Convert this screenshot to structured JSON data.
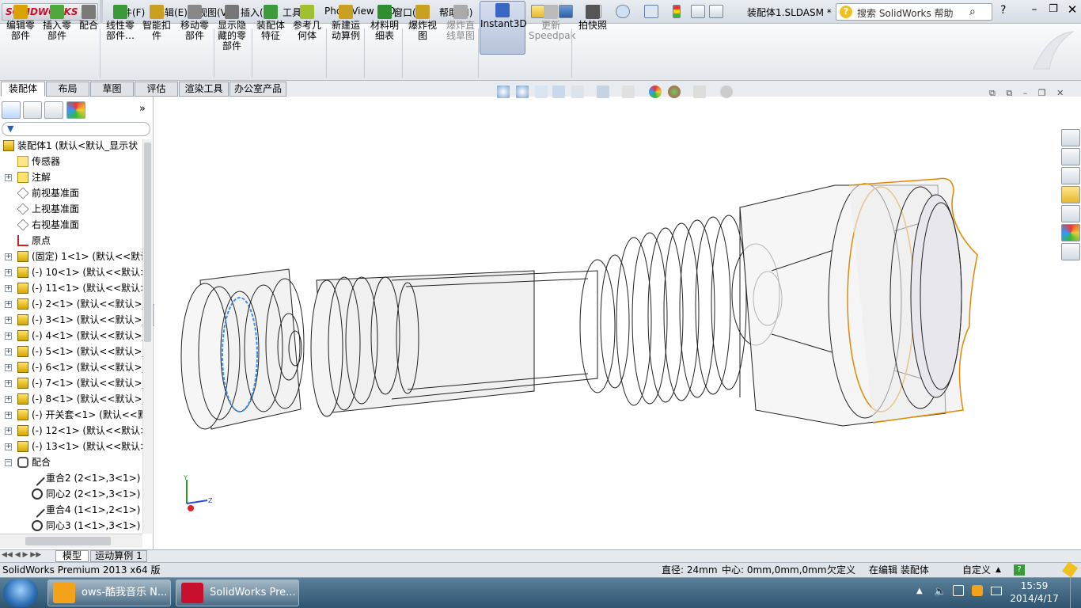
{
  "app": {
    "logo": "SOLIDWORKS",
    "doc_title": "装配体1.SLDASM *",
    "search_placeholder": "搜索 SolidWorks 帮助"
  },
  "menu": [
    "文件(F)",
    "编辑(E)",
    "视图(V)",
    "插入(I)",
    "工具(T)",
    "PhotoView 360",
    "窗口(W)",
    "帮助(H)"
  ],
  "ribbon": [
    {
      "label": "编辑零\n部件",
      "icon": "edit-component-icon",
      "color": "#d9a400"
    },
    {
      "label": "插入零\n部件",
      "icon": "insert-component-icon",
      "color": "#4fa83a"
    },
    {
      "label": "配合",
      "icon": "mate-icon",
      "color": "#7a7a7a"
    },
    {
      "label": "线性零\n部件…",
      "icon": "linear-pattern-icon",
      "color": "#3a9a3a"
    },
    {
      "label": "智能扣\n件",
      "icon": "smart-fasteners-icon",
      "color": "#c9a020"
    },
    {
      "label": "移动零\n部件",
      "icon": "move-component-icon",
      "color": "#888888"
    },
    {
      "label": "显示隐\n藏的零\n部件",
      "icon": "show-hidden-icon",
      "color": "#777777"
    },
    {
      "label": "装配体\n特征",
      "icon": "assembly-features-icon",
      "color": "#3c9a3c"
    },
    {
      "label": "参考几\n何体",
      "icon": "reference-geometry-icon",
      "color": "#a0c030"
    },
    {
      "label": "新建运\n动算例",
      "icon": "new-motion-study-icon",
      "color": "#c9a020"
    },
    {
      "label": "材料明\n细表",
      "icon": "bom-icon",
      "color": "#2f8f2f"
    },
    {
      "label": "爆炸视\n图",
      "icon": "exploded-view-icon",
      "color": "#c9a020"
    },
    {
      "label": "爆炸直\n线草图",
      "icon": "explode-line-sketch-icon",
      "color": "#aaaaaa",
      "disabled": true
    },
    {
      "label": "Instant3D",
      "icon": "instant3d-icon",
      "color": "#3a66c4",
      "active": true
    },
    {
      "label": "更新\nSpeedpak",
      "icon": "speedpak-icon",
      "color": "#bbbbbb",
      "disabled": true
    },
    {
      "label": "拍快照",
      "icon": "snapshot-icon",
      "color": "#555555"
    }
  ],
  "cm_tabs": [
    "装配体",
    "布局",
    "草图",
    "评估",
    "渲染工具",
    "办公室产品"
  ],
  "tree": {
    "root": "装配体1  (默认<默认_显示状",
    "items": [
      {
        "t": "传感器",
        "icon": "sensor-icon",
        "exp": false,
        "indent": 1
      },
      {
        "t": "注解",
        "icon": "annotation-icon",
        "exp": true,
        "indent": 1
      },
      {
        "t": "前视基准面",
        "icon": "plane-icon",
        "exp": false,
        "indent": 1
      },
      {
        "t": "上视基准面",
        "icon": "plane-icon",
        "exp": false,
        "indent": 1
      },
      {
        "t": "右视基准面",
        "icon": "plane-icon",
        "exp": false,
        "indent": 1
      },
      {
        "t": "原点",
        "icon": "origin-icon",
        "exp": false,
        "indent": 1
      },
      {
        "t": "(固定) 1<1> (默认<<默认",
        "icon": "part-icon",
        "exp": true,
        "indent": 0
      },
      {
        "t": "(-) 10<1> (默认<<默认>",
        "icon": "part-icon",
        "exp": true,
        "indent": 0
      },
      {
        "t": "(-) 11<1> (默认<<默认>",
        "icon": "part-icon",
        "exp": true,
        "indent": 0
      },
      {
        "t": "(-) 2<1> (默认<<默认>_",
        "icon": "part-icon",
        "exp": true,
        "indent": 0
      },
      {
        "t": "(-) 3<1> (默认<<默认>_",
        "icon": "part-icon",
        "exp": true,
        "indent": 0
      },
      {
        "t": "(-) 4<1> (默认<<默认>_",
        "icon": "part-icon",
        "exp": true,
        "indent": 0
      },
      {
        "t": "(-) 5<1> (默认<<默认>_",
        "icon": "part-icon",
        "exp": true,
        "indent": 0
      },
      {
        "t": "(-) 6<1> (默认<<默认>_",
        "icon": "part-icon",
        "exp": true,
        "indent": 0
      },
      {
        "t": "(-) 7<1> (默认<<默认>_",
        "icon": "part-icon",
        "exp": true,
        "indent": 0
      },
      {
        "t": "(-) 8<1> (默认<<默认>_",
        "icon": "part-icon",
        "exp": true,
        "indent": 0
      },
      {
        "t": "(-) 开关套<1> (默认<<默",
        "icon": "part-icon",
        "exp": true,
        "indent": 0
      },
      {
        "t": "(-) 12<1> (默认<<默认>",
        "icon": "part-icon",
        "exp": true,
        "indent": 0
      },
      {
        "t": "(-) 13<1> (默认<<默认>",
        "icon": "part-icon",
        "exp": true,
        "indent": 0
      },
      {
        "t": "配合",
        "icon": "mates-folder-icon",
        "exp": "open",
        "indent": 0
      },
      {
        "t": "重合2 (2<1>,3<1>)",
        "icon": "coincident-icon",
        "exp": false,
        "indent": 2
      },
      {
        "t": "同心2 (2<1>,3<1>)",
        "icon": "concentric-icon",
        "exp": false,
        "indent": 2
      },
      {
        "t": "重合4 (1<1>,2<1>)",
        "icon": "coincident-icon",
        "exp": false,
        "indent": 2
      },
      {
        "t": "同心3 (1<1>,3<1>)",
        "icon": "concentric-icon",
        "exp": false,
        "indent": 2
      }
    ]
  },
  "bottom_tabs": [
    "模型",
    "运动算例 1"
  ],
  "status": {
    "left": "SolidWorks Premium 2013 x64 版",
    "diameter": "直径: 24mm",
    "center": "中心: 0mm,0mm,0mm",
    "constraint": "欠定义",
    "editing": "在编辑 装配体",
    "units": "自定义"
  },
  "taskbar": {
    "tasks": [
      {
        "label": "ows-酷我音乐 N...",
        "icon": "kuwo-icon",
        "color": "#f4a21a"
      },
      {
        "label": "SolidWorks Pre...",
        "icon": "solidworks-icon",
        "color": "#c8102e"
      }
    ],
    "time": "15:59",
    "date": "2014/4/17"
  },
  "triad": {
    "x": "X",
    "y": "Y",
    "z": "Z"
  },
  "colors": {
    "accent": "#c8102e",
    "selection_orange": "#e08a00",
    "selection_blue": "#3d8ee8"
  }
}
